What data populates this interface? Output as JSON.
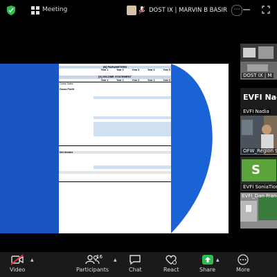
{
  "topbar": {
    "meeting_label": "Meeting",
    "sharer_name": "DOST IX | MARVIN B BASIR"
  },
  "sheet": {
    "parameters_title": "[B] PARAMETERS",
    "income_title": "[D] INCOME STATEMENT",
    "year_headers": [
      "Year 1",
      "Year 2",
      "Year 3",
      "Year 4",
      "Year 5"
    ],
    "labels": {
      "gross_sales": "Gross Sales",
      "gross_profit": "Gross Profit",
      "net_income": "Net Income"
    }
  },
  "participants": {
    "tile1": "DOST IX | M",
    "tile2_big": "EVFI Nadia",
    "tile2_small": "EVFI Nadia",
    "tile3": "OFW_Region 9",
    "tile4_initial": "S",
    "tile4": "EVFI SoniaTion",
    "tile5": "EVFI_Dan Fran"
  },
  "toolbar": {
    "video": "Video",
    "participants": "Participants",
    "participants_count": "16",
    "chat": "Chat",
    "react": "React",
    "share": "Share",
    "more": "More"
  }
}
